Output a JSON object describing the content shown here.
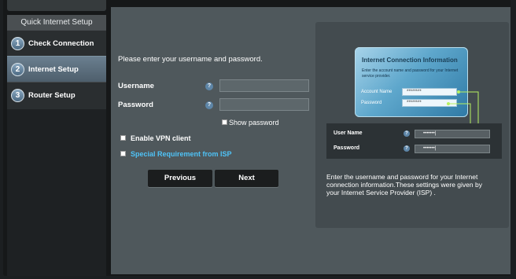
{
  "sidebar": {
    "title": "Quick Internet Setup",
    "items": [
      {
        "num": "1",
        "label": "Check Connection"
      },
      {
        "num": "2",
        "label": "Internet Setup"
      },
      {
        "num": "3",
        "label": "Router Setup"
      }
    ]
  },
  "form": {
    "prompt": "Please enter your username and password.",
    "username_label": "Username",
    "password_label": "Password",
    "help_glyph": "?",
    "username_value": "",
    "password_value": "",
    "show_password_label": "Show password",
    "vpn_label": "Enable VPN client",
    "isp_label": "Special Requirement from ISP"
  },
  "buttons": {
    "previous": "Previous",
    "next": "Next"
  },
  "illustration": {
    "card_title": "Internet Connection Information",
    "card_subtitle": "Enter the account name and password for your Internet service provider.",
    "account_label": "Account Name",
    "account_value": "********",
    "password_label": "Password",
    "password_value": "********",
    "mini_user_label": "User Name",
    "mini_password_label": "Password",
    "mini_user_value": "•••••••|",
    "mini_password_value": "•••••••|"
  },
  "description": "Enter the username and password for your Internet connection information.These settings were given by your Internet Service Provider (ISP) .",
  "colors": {
    "accent_link": "#4fc3f7",
    "panel": "#4f585c",
    "green_connector": "#b7f060"
  }
}
